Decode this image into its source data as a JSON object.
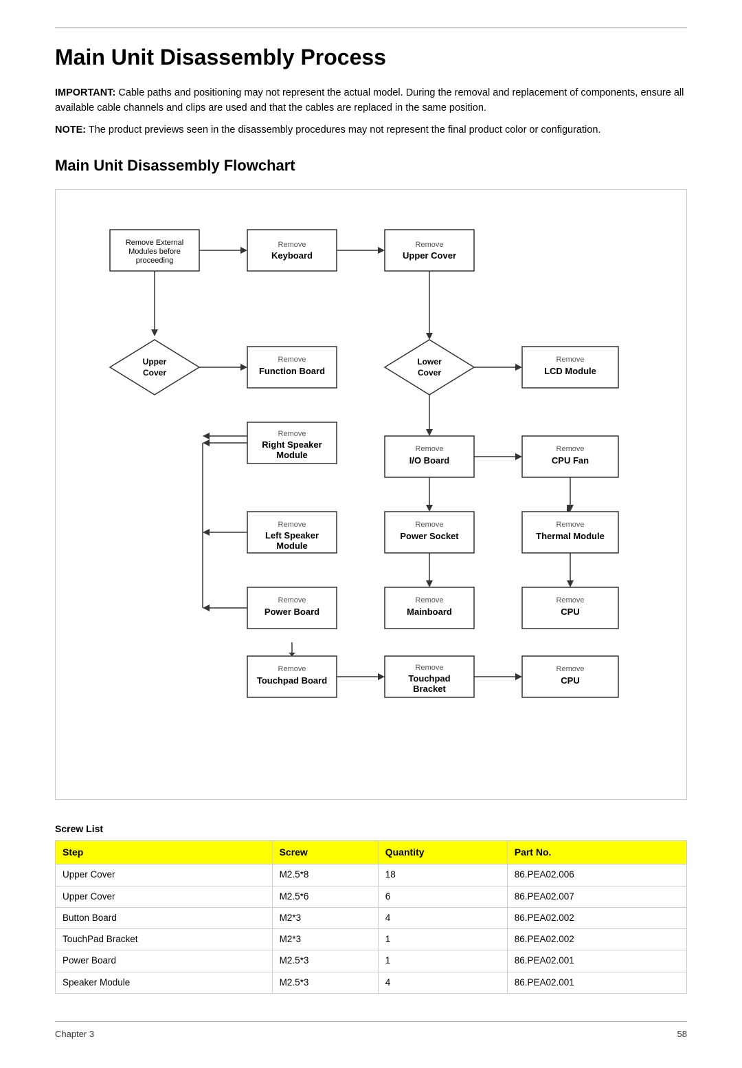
{
  "page": {
    "title": "Main Unit Disassembly Process",
    "subtitle": "Main Unit Disassembly Flowchart",
    "important_label": "IMPORTANT:",
    "important_text": " Cable paths and positioning may not represent the actual model. During the removal and replacement of components, ensure all available cable channels and clips are used and that the cables are replaced in the same position.",
    "note_label": "NOTE:",
    "note_text": " The product previews seen in the disassembly procedures may not represent the final product color or configuration."
  },
  "flowchart": {
    "nodes": [
      {
        "id": "start",
        "text": "Remove External\nModules before\nproceeding",
        "type": "rect"
      },
      {
        "id": "keyboard",
        "text_small": "Remove",
        "text_bold": "Keyboard",
        "type": "rect"
      },
      {
        "id": "upper_cover_top",
        "text_small": "Remove",
        "text_bold": "Upper Cover",
        "type": "rect"
      },
      {
        "id": "upper_cover_diamond",
        "text_bold": "Upper\nCover",
        "type": "diamond"
      },
      {
        "id": "function_board",
        "text_small": "Remove",
        "text_bold": "Function Board",
        "type": "rect"
      },
      {
        "id": "lower_cover_diamond",
        "text_bold": "Lower\nCover",
        "type": "diamond"
      },
      {
        "id": "right_speaker",
        "text_small": "Remove",
        "text_bold": "Right Speaker\nModule",
        "type": "rect"
      },
      {
        "id": "io_board",
        "text_small": "Remove",
        "text_bold": "I/O Board",
        "type": "rect"
      },
      {
        "id": "lcd_module",
        "text_small": "Remove",
        "text_bold": "LCD Module",
        "type": "rect"
      },
      {
        "id": "left_speaker",
        "text_small": "Remove",
        "text_bold": "Left Speaker\nModule",
        "type": "rect"
      },
      {
        "id": "power_socket",
        "text_small": "Remove",
        "text_bold": "Power Socket",
        "type": "rect"
      },
      {
        "id": "cpu_fan",
        "text_small": "Remove",
        "text_bold": "CPU Fan",
        "type": "rect"
      },
      {
        "id": "power_board",
        "text_small": "Remove",
        "text_bold": "Power Board",
        "type": "rect"
      },
      {
        "id": "mainboard",
        "text_small": "Remove",
        "text_bold": "Mainboard",
        "type": "rect"
      },
      {
        "id": "thermal_module",
        "text_small": "Remove",
        "text_bold": "Thermal Module",
        "type": "rect"
      },
      {
        "id": "touchpad_board",
        "text_small": "Remove",
        "text_bold": "Touchpad Board",
        "type": "rect"
      },
      {
        "id": "touchpad_bracket",
        "text_small": "Remove",
        "text_bold": "Touchpad\nBracket",
        "type": "rect"
      },
      {
        "id": "cpu",
        "text_small": "Remove",
        "text_bold": "CPU",
        "type": "rect"
      }
    ]
  },
  "screw_list": {
    "title": "Screw List",
    "headers": [
      "Step",
      "Screw",
      "Quantity",
      "Part No."
    ],
    "rows": [
      {
        "step": "Upper Cover",
        "screw": "M2.5*8",
        "quantity": "18",
        "part_no": "86.PEA02.006"
      },
      {
        "step": "Upper Cover",
        "screw": "M2.5*6",
        "quantity": "6",
        "part_no": "86.PEA02.007"
      },
      {
        "step": "Button Board",
        "screw": "M2*3",
        "quantity": "4",
        "part_no": "86.PEA02.002"
      },
      {
        "step": "TouchPad Bracket",
        "screw": "M2*3",
        "quantity": "1",
        "part_no": "86.PEA02.002"
      },
      {
        "step": "Power Board",
        "screw": "M2.5*3",
        "quantity": "1",
        "part_no": "86.PEA02.001"
      },
      {
        "step": "Speaker Module",
        "screw": "M2.5*3",
        "quantity": "4",
        "part_no": "86.PEA02.001"
      }
    ]
  },
  "footer": {
    "left": "Chapter 3",
    "right": "58"
  }
}
